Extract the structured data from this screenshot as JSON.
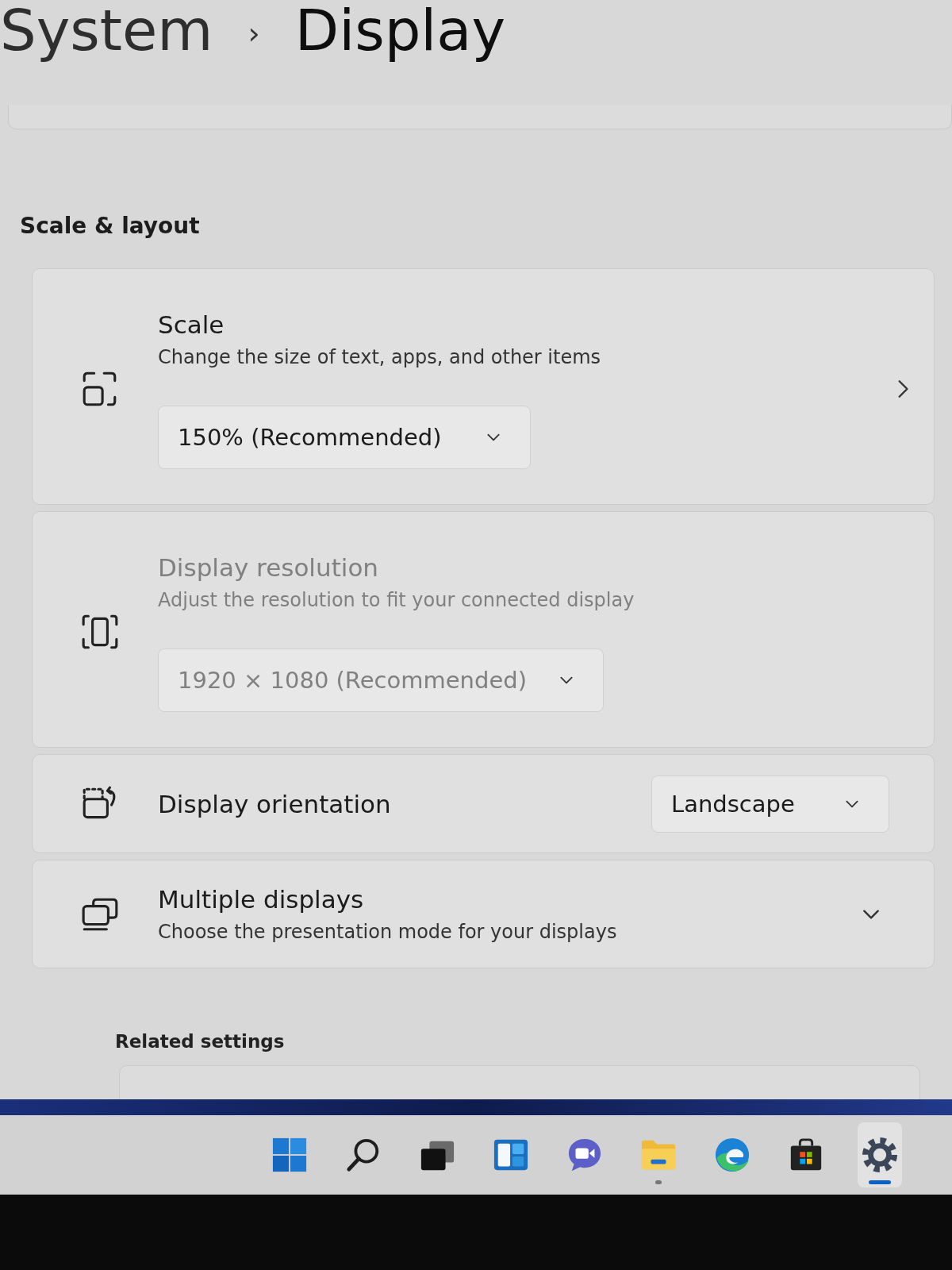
{
  "breadcrumb": {
    "items": [
      "System",
      "Display"
    ],
    "separator": "›"
  },
  "section_title": "Scale & layout",
  "settings": [
    {
      "kind": "stacked",
      "title": "Scale",
      "description": "Change the size of text, apps, and other items",
      "value": "150% (Recommended)",
      "disabled": false,
      "link": true
    },
    {
      "kind": "stacked",
      "title": "Display resolution",
      "description": "Adjust the resolution to fit your connected display",
      "value": "1920 × 1080 (Recommended)",
      "disabled": true,
      "link": false
    },
    {
      "kind": "inline",
      "title": "Display orientation",
      "value": "Landscape",
      "disabled": false,
      "link": false
    },
    {
      "kind": "expander",
      "title": "Multiple displays",
      "description": "Choose the presentation mode for your displays",
      "disabled": false,
      "link": false,
      "expanded": false
    }
  ],
  "related_title": "Related settings",
  "taskbar": {
    "items": [
      {
        "kind": "start",
        "selected": false,
        "running": false
      },
      {
        "kind": "search",
        "selected": false,
        "running": false
      },
      {
        "kind": "taskview",
        "selected": false,
        "running": false
      },
      {
        "kind": "widgets",
        "selected": false,
        "running": false
      },
      {
        "kind": "chat",
        "selected": false,
        "running": false
      },
      {
        "kind": "folder",
        "selected": false,
        "running": true
      },
      {
        "kind": "browser",
        "selected": false,
        "running": false
      },
      {
        "kind": "store",
        "selected": false,
        "running": false
      },
      {
        "kind": "gear",
        "selected": true,
        "running": true
      }
    ]
  }
}
